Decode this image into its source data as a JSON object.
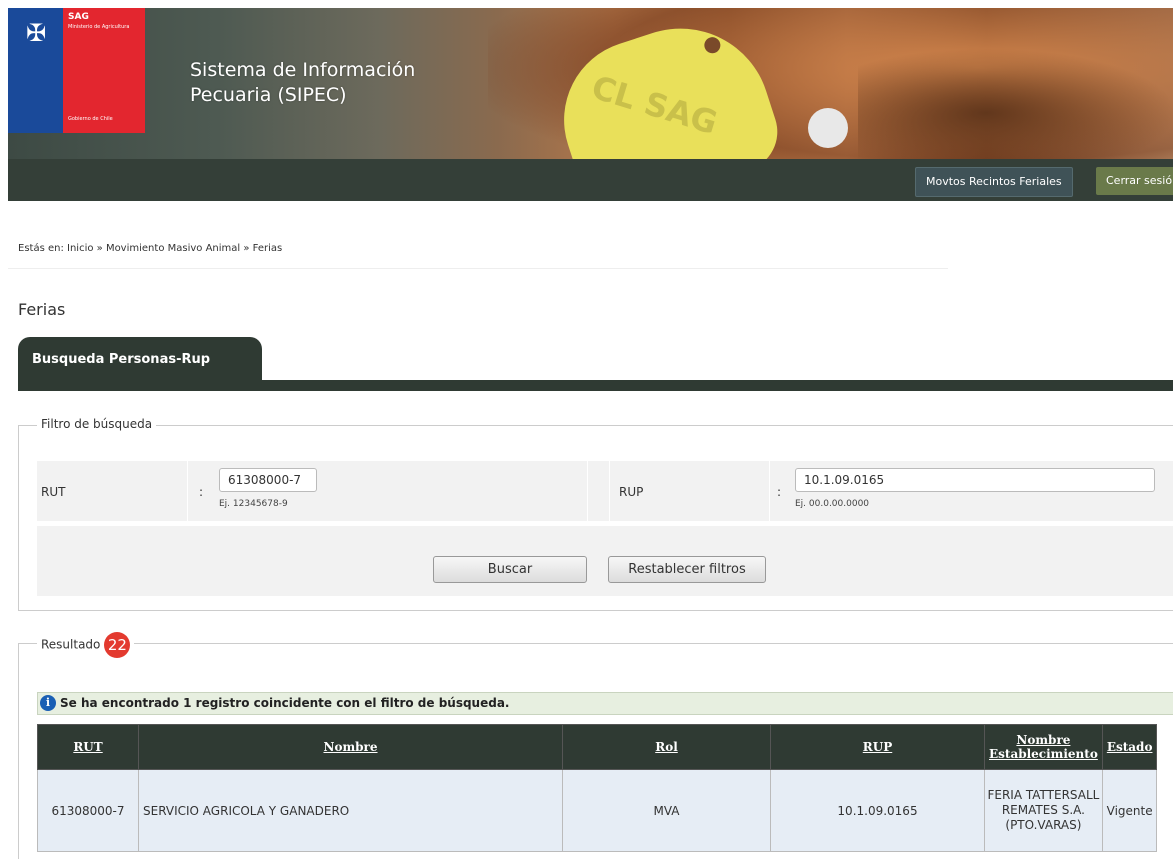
{
  "header": {
    "logo": {
      "org": "SAG",
      "ministry": "Ministerio de Agricultura",
      "government": "Gobierno de Chile"
    },
    "title_line1": "Sistema de Información",
    "title_line2": "Pecuaria (SIPEC)",
    "nav": {
      "recintos": "Movtos Recintos Feriales",
      "logout": "Cerrar sesión"
    }
  },
  "breadcrumb": "Estás en: Inicio » Movimiento Masivo Animal » Ferias",
  "page_title": "Ferias",
  "tab": "Busqueda Personas-Rup",
  "filter": {
    "legend": "Filtro de búsqueda",
    "rut_label": "RUT",
    "rut_value": "61308000-7",
    "rut_hint": "Ej. 12345678-9",
    "rup_label": "RUP",
    "rup_value": "10.1.09.0165",
    "rup_hint": "Ej. 00.0.00.0000",
    "colon": ":",
    "search_btn": "Buscar",
    "reset_btn": "Restablecer filtros"
  },
  "result": {
    "legend": "Resultado",
    "badge": "22",
    "message": "Se ha encontrado 1 registro coincidente con el filtro de búsqueda.",
    "columns": {
      "rut": "RUT",
      "nombre": "Nombre",
      "rol": "Rol",
      "rup": "RUP",
      "establecimiento": "Nombre Establecimiento",
      "estado": "Estado"
    },
    "rows": [
      {
        "rut": "61308000-7",
        "nombre": "SERVICIO AGRICOLA Y GANADERO",
        "rol": "MVA",
        "rup": "10.1.09.0165",
        "establecimiento": "FERIA TATTERSALL REMATES S.A. (PTO.VARAS)",
        "estado": "Vigente"
      }
    ]
  }
}
